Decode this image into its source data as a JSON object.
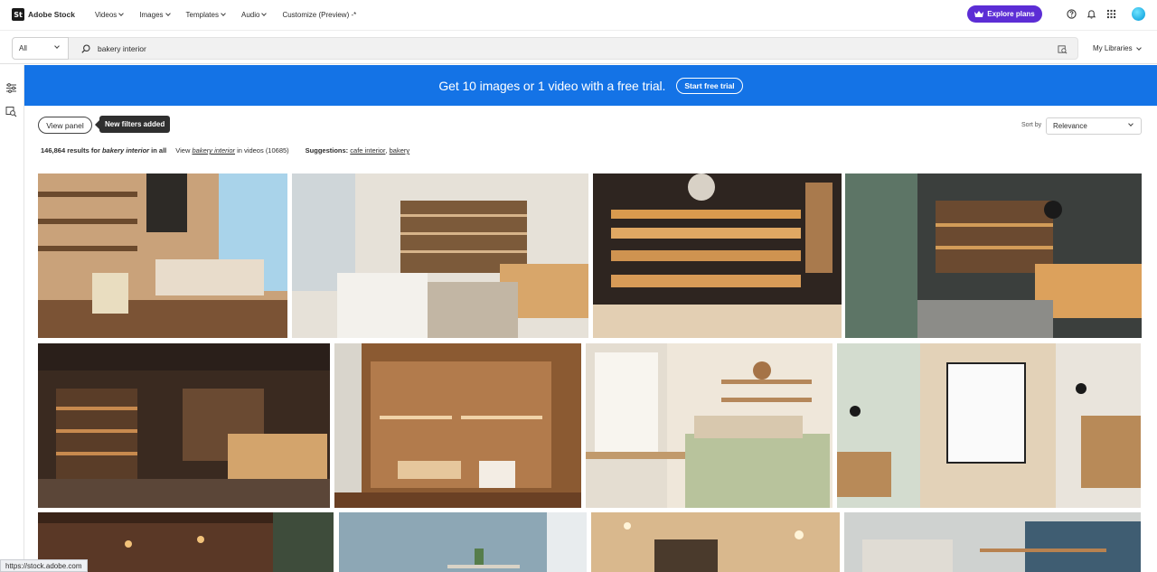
{
  "app": {
    "logo_mark": "St",
    "logo_text": "Adobe Stock"
  },
  "nav": {
    "items": [
      {
        "label": "Videos"
      },
      {
        "label": "Images"
      },
      {
        "label": "Templates"
      },
      {
        "label": "Audio"
      },
      {
        "label": "Customize (Preview) -*"
      }
    ],
    "explore_label": "Explore plans",
    "accent_color": "#5c2dd5"
  },
  "search": {
    "filter_value": "All",
    "query": "bakery interior",
    "my_libraries": "My Libraries"
  },
  "banner": {
    "text": "Get 10 images or 1 video with a free trial.",
    "button_label": "Start free trial",
    "color": "#1473e6"
  },
  "filters": {
    "view_panel_label": "View panel",
    "tooltip": "New filters added",
    "sort_label": "Sort by",
    "sort_value": "Relevance"
  },
  "results": {
    "count_text": "146,864 results for",
    "query_text": "bakery interior",
    "in_all_text": "in all",
    "view_prefix": "View",
    "video_link": "bakery interior",
    "video_suffix": "in videos",
    "video_count": "(10685)",
    "suggestions_label": "Suggestions:",
    "suggestions": [
      "cafe interior",
      "bakery"
    ]
  },
  "status_url": "https://stock.adobe.com"
}
